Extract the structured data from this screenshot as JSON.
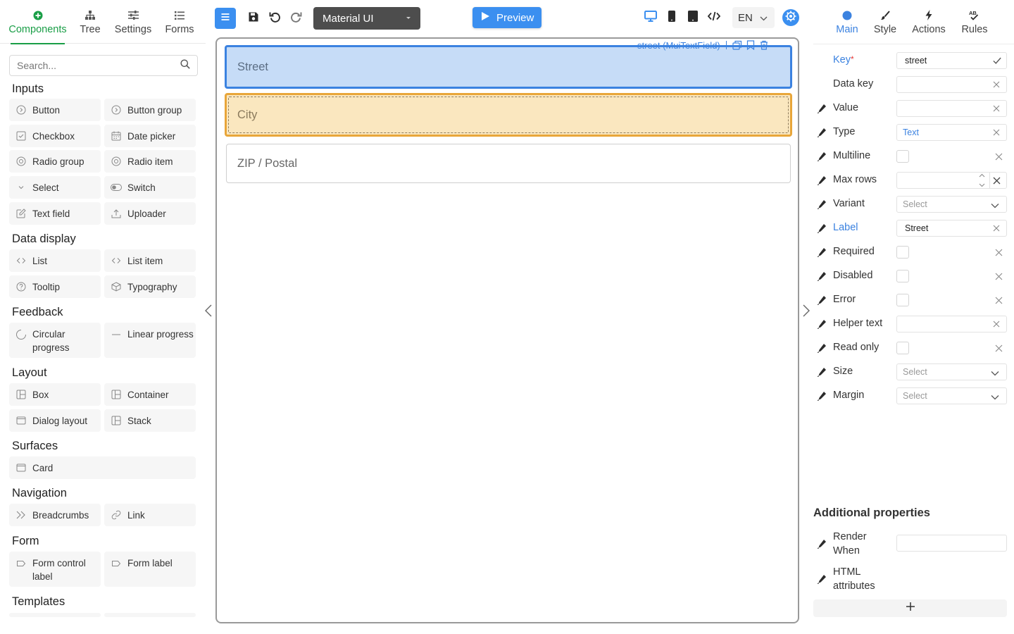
{
  "left_tabs": [
    {
      "label": "Components",
      "icon": "plus-circle-icon",
      "active": true
    },
    {
      "label": "Tree",
      "icon": "sitemap-icon"
    },
    {
      "label": "Settings",
      "icon": "sliders-icon"
    },
    {
      "label": "Forms",
      "icon": "list-icon"
    }
  ],
  "search": {
    "placeholder": "Search..."
  },
  "groups": {
    "inputs": {
      "title": "Inputs",
      "items": [
        "Button",
        "Button group",
        "Checkbox",
        "Date picker",
        "Radio group",
        "Radio item",
        "Select",
        "Switch",
        "Text field",
        "Uploader"
      ]
    },
    "data_display": {
      "title": "Data display",
      "items": [
        "List",
        "List item",
        "Tooltip",
        "Typography"
      ]
    },
    "feedback": {
      "title": "Feedback",
      "items": [
        "Circular\nprogress",
        "Linear progress"
      ]
    },
    "layout": {
      "title": "Layout",
      "items": [
        "Box",
        "Container",
        "Dialog layout",
        "Stack"
      ]
    },
    "surfaces": {
      "title": "Surfaces",
      "items": [
        "Card"
      ]
    },
    "navigation": {
      "title": "Navigation",
      "items": [
        "Breadcrumbs",
        "Link"
      ]
    },
    "form": {
      "title": "Form",
      "items": [
        "Form control\nlabel",
        "Form label"
      ]
    },
    "templates": {
      "title": "Templates"
    }
  },
  "toolbar": {
    "library": "Material UI",
    "preview": "Preview",
    "language": "EN"
  },
  "canvas": {
    "selection_label": "street (MuiTextField)",
    "fields": {
      "street": "Street",
      "city": "City",
      "zip": "ZIP / Postal"
    }
  },
  "right_tabs": [
    {
      "label": "Main",
      "icon": "circle-icon",
      "active": true
    },
    {
      "label": "Style",
      "icon": "brush-icon"
    },
    {
      "label": "Actions",
      "icon": "bolt-icon"
    },
    {
      "label": "Rules",
      "icon": "spellcheck-icon"
    }
  ],
  "properties": {
    "key": {
      "label": "Key",
      "value": "street"
    },
    "data_key": {
      "label": "Data key",
      "value": ""
    },
    "value": {
      "label": "Value",
      "value": ""
    },
    "type": {
      "label": "Type",
      "value": "Text"
    },
    "multiline": {
      "label": "Multiline"
    },
    "max_rows": {
      "label": "Max rows",
      "value": ""
    },
    "variant": {
      "label": "Variant",
      "value": "Select"
    },
    "label": {
      "label": "Label",
      "value": "Street"
    },
    "required": {
      "label": "Required"
    },
    "disabled": {
      "label": "Disabled"
    },
    "error": {
      "label": "Error"
    },
    "helper_text": {
      "label": "Helper text",
      "value": ""
    },
    "read_only": {
      "label": "Read only"
    },
    "size": {
      "label": "Size",
      "value": "Select"
    },
    "margin": {
      "label": "Margin",
      "value": "Select"
    }
  },
  "additional": {
    "title": "Additional properties",
    "render_when": "Render\nWhen",
    "html_attributes": "HTML\nattributes",
    "add_label": "+"
  },
  "colors": {
    "accent_blue": "#3b8ff0",
    "accent_green": "#1a9e47",
    "selected_field": "#c6dcf7",
    "hover_field": "#fae7bf"
  }
}
